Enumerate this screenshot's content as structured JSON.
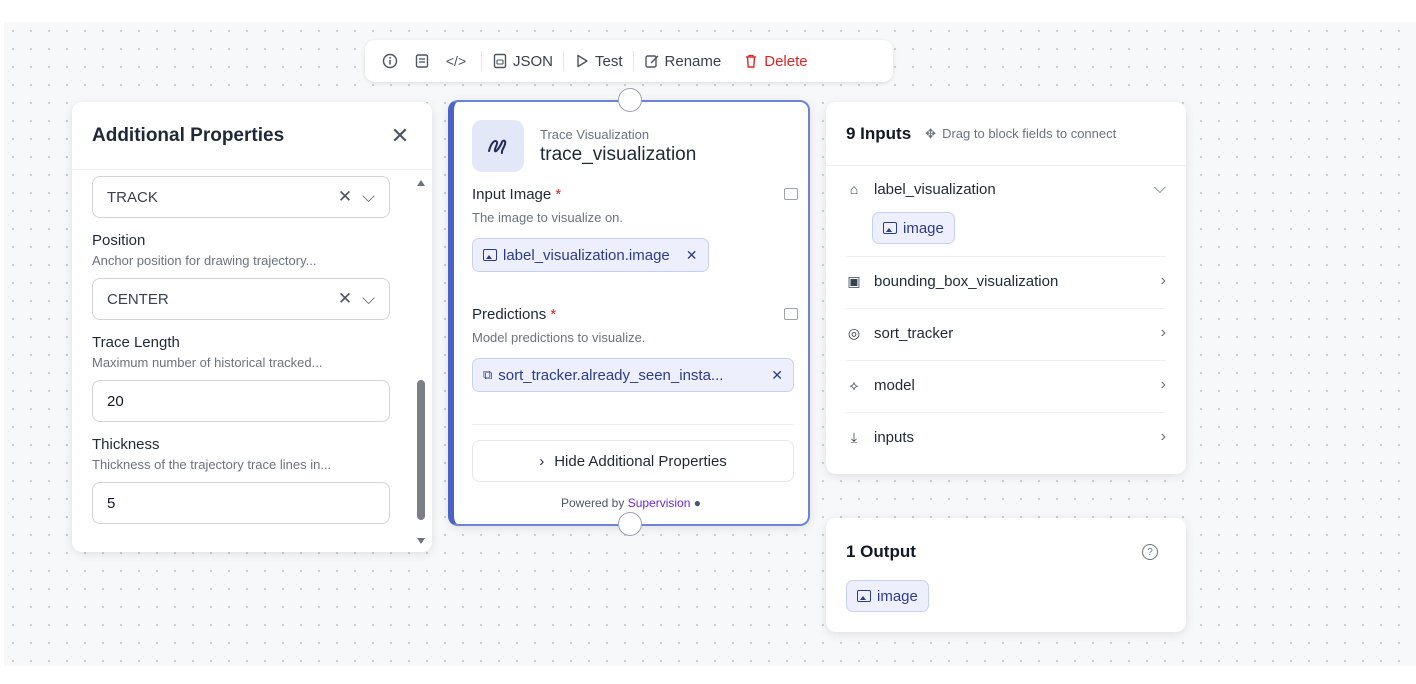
{
  "toolbar": {
    "json_label": "JSON",
    "test_label": "Test",
    "rename_label": "Rename",
    "delete_label": "Delete"
  },
  "properties_panel": {
    "title": "Additional Properties",
    "first_select_value": "TRACK",
    "position": {
      "label": "Position",
      "description": "Anchor position for drawing trajectory...",
      "value": "CENTER"
    },
    "trace_length": {
      "label": "Trace Length",
      "description": "Maximum number of historical tracked...",
      "value": "20"
    },
    "thickness": {
      "label": "Thickness",
      "description": "Thickness of the trajectory trace lines in...",
      "value": "5"
    }
  },
  "block": {
    "type_label": "Trace Visualization",
    "name": "trace_visualization",
    "input_image": {
      "label": "Input Image",
      "required_mark": "*",
      "description": "The image to visualize on.",
      "chip": "label_visualization.image"
    },
    "predictions": {
      "label": "Predictions",
      "required_mark": "*",
      "description": "Model predictions to visualize.",
      "chip": "sort_tracker.already_seen_insta..."
    },
    "hide_button": "Hide Additional Properties",
    "powered_by_prefix": "Powered by",
    "powered_by_brand": "Supervision"
  },
  "inputs_panel": {
    "title": "9 Inputs",
    "hint": "Drag to block fields to connect",
    "rows": [
      {
        "label": "label_visualization",
        "icon": "tag-icon",
        "expanded": true
      },
      {
        "label": "bounding_box_visualization",
        "icon": "box-image-icon",
        "expanded": false
      },
      {
        "label": "sort_tracker",
        "icon": "target-icon",
        "expanded": false
      },
      {
        "label": "model",
        "icon": "network-icon",
        "expanded": false
      },
      {
        "label": "inputs",
        "icon": "download-icon",
        "expanded": false
      }
    ],
    "expanded_chip": "image"
  },
  "output_panel": {
    "title": "1 Output",
    "chip": "image"
  },
  "colors": {
    "accent": "#4b63c6",
    "chip_bg": "#edf0fc",
    "chip_text": "#2d3b8c",
    "danger": "#dc2626",
    "brand": "#6d28d9"
  }
}
